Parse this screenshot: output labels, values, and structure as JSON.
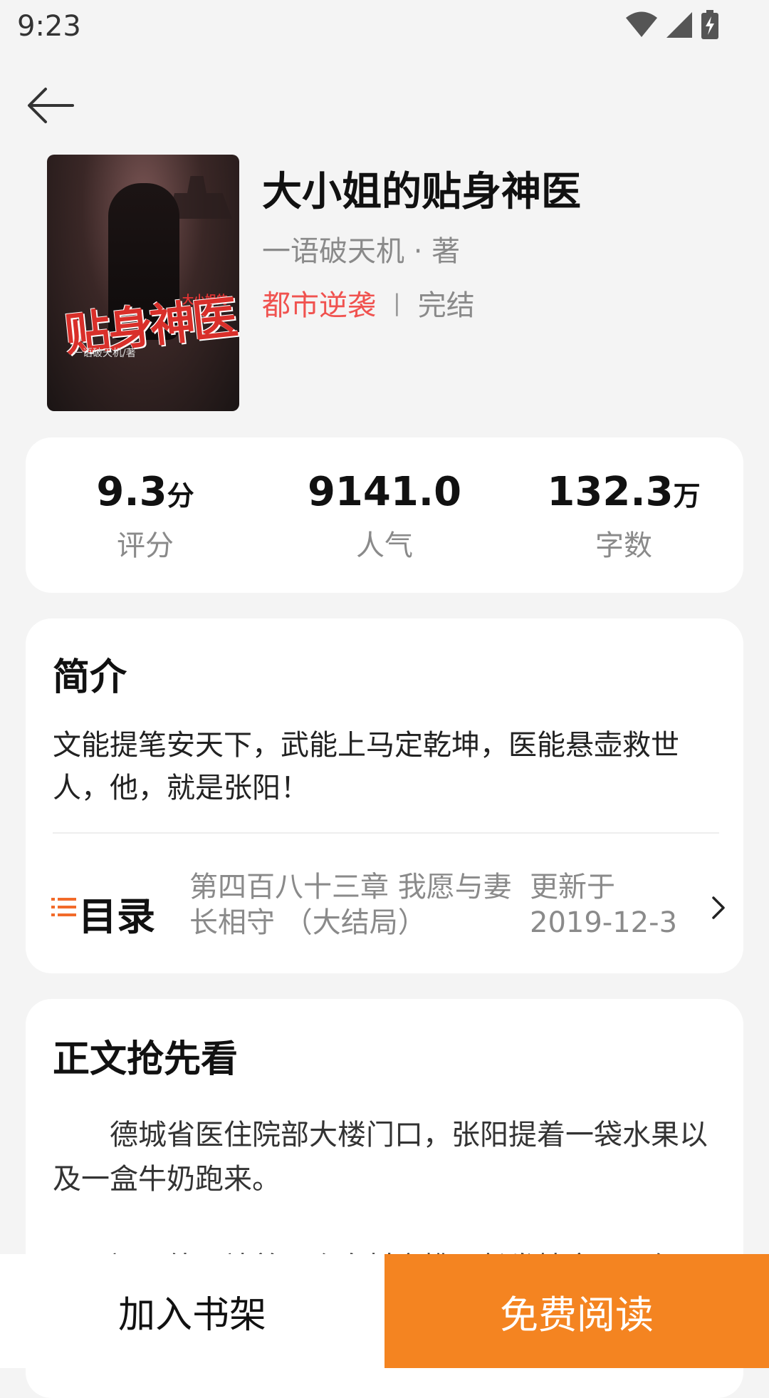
{
  "status_bar": {
    "time": "9:23",
    "icons": [
      "wifi-icon",
      "cellular-signal-icon",
      "battery-charging-icon"
    ]
  },
  "nav": {
    "back_icon": "back-arrow-icon"
  },
  "book": {
    "title": "大小姐的贴身神医",
    "author": "一语破天机 · 著",
    "category": "都市逆袭",
    "separator": "|",
    "status": "完结",
    "cover": {
      "title": "贴身神医",
      "small_title": "大小姐的",
      "author": "一语破天机/著"
    }
  },
  "stats": {
    "rating": {
      "value": "9.3",
      "unit": "分",
      "label": "评分"
    },
    "popularity": {
      "value": "9141.0",
      "unit": "",
      "label": "人气"
    },
    "words": {
      "value": "132.3",
      "unit": "万",
      "label": "字数"
    }
  },
  "intro": {
    "title": "简介",
    "text": "文能提笔安天下，武能上马定乾坤，医能悬壶救世人，他，就是张阳！"
  },
  "toc": {
    "label": "目录",
    "latest_chapter": "第四百八十三章 我愿与妻长相守 （大结局）",
    "updated_label": "更新于",
    "updated_date": "2019-12-3"
  },
  "preview": {
    "title": "正文抢先看",
    "paragraphs": [
      "德城省医住院部大楼门口，张阳提着一袋水果以及一盒牛奶跑来。",
      "门口外，站着一个身材高挑，长发披肩，唇红"
    ]
  },
  "actions": {
    "add_to_shelf": "加入书架",
    "read_free": "免费阅读"
  },
  "colors": {
    "accent_orange": "#f48421",
    "category_red": "#f0524f",
    "toc_icon": "#f26b2a"
  }
}
